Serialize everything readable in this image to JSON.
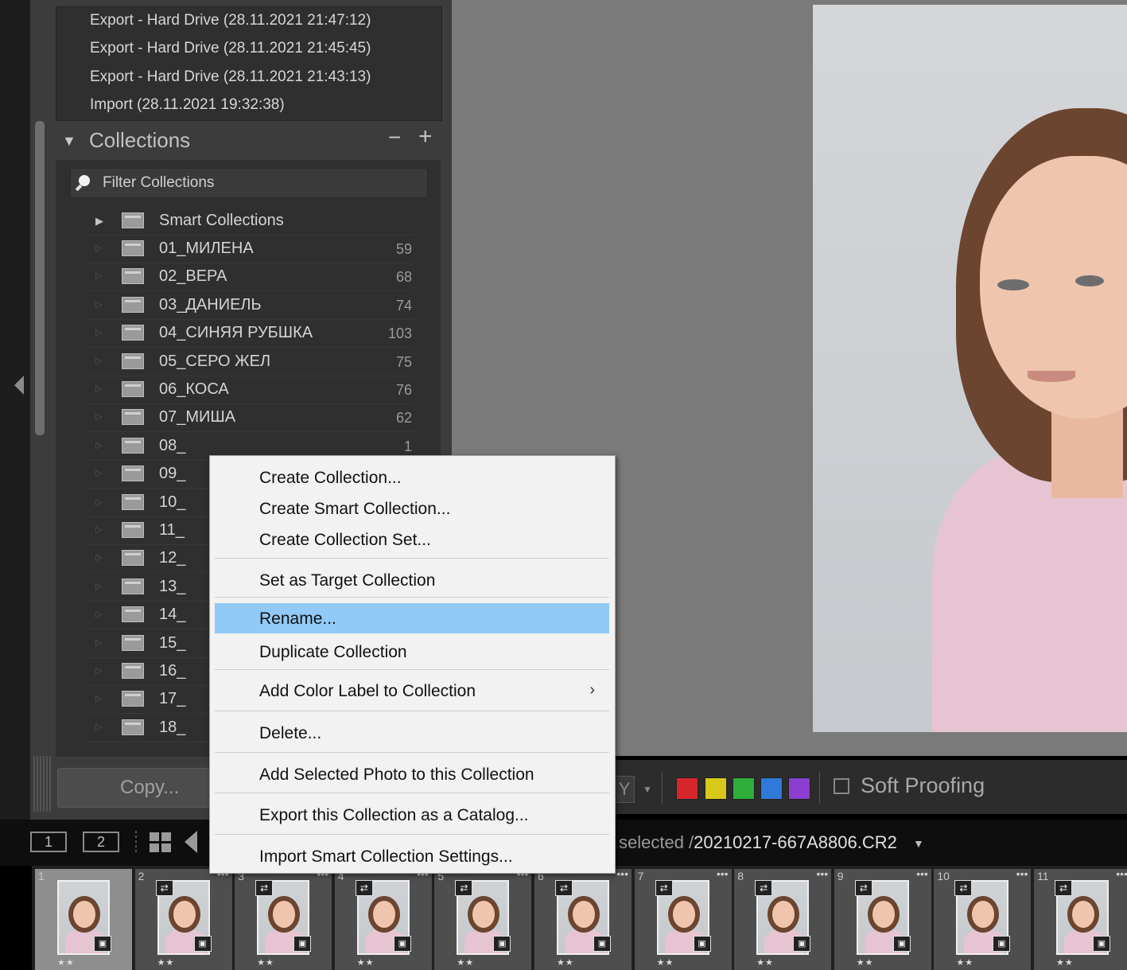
{
  "history": [
    "Export - Hard Drive (28.11.2021 21:47:12)",
    "Export - Hard Drive (28.11.2021 21:45:45)",
    "Export - Hard Drive (28.11.2021 21:43:13)",
    "Import (28.11.2021 19:32:38)"
  ],
  "collections": {
    "title": "Collections",
    "minus": "−",
    "plus": "+",
    "filter_placeholder": "Filter Collections",
    "smart_label": "Smart Collections",
    "items": [
      {
        "name": "01_МИЛЕНА",
        "count": "59"
      },
      {
        "name": "02_ВЕРА",
        "count": "68"
      },
      {
        "name": "03_ДАНИЕЛЬ",
        "count": "74"
      },
      {
        "name": "04_СИНЯЯ РУБШКА",
        "count": "103"
      },
      {
        "name": "05_СЕРО ЖЕЛ",
        "count": "75"
      },
      {
        "name": "06_КОСА",
        "count": "76"
      },
      {
        "name": "07_МИША",
        "count": "62"
      },
      {
        "name": "08_",
        "count": "1"
      },
      {
        "name": "09_",
        "count": ""
      },
      {
        "name": "10_",
        "count": ""
      },
      {
        "name": "11_",
        "count": ""
      },
      {
        "name": "12_",
        "count": ""
      },
      {
        "name": "13_",
        "count": ""
      },
      {
        "name": "14_",
        "count": ""
      },
      {
        "name": "15_",
        "count": ""
      },
      {
        "name": "16_",
        "count": ""
      },
      {
        "name": "17_",
        "count": ""
      },
      {
        "name": "18_",
        "count": ""
      }
    ],
    "copy_button": "Copy..."
  },
  "context_menu": {
    "items": [
      {
        "label": "Create Collection..."
      },
      {
        "label": "Create Smart Collection..."
      },
      {
        "label": "Create Collection Set..."
      },
      {
        "label": "Set as Target Collection"
      },
      {
        "label": "Rename...",
        "highlighted": true
      },
      {
        "label": "Duplicate Collection"
      },
      {
        "label": "Add Color Label to Collection",
        "submenu": "›"
      },
      {
        "label": "Delete..."
      },
      {
        "label": "Add Selected Photo to this Collection"
      },
      {
        "label": "Export this Collection as a Catalog..."
      },
      {
        "label": "Import Smart Collection Settings..."
      }
    ]
  },
  "toolbar": {
    "y_label": "Y",
    "soft_proofing": "Soft Proofing",
    "color_labels": [
      "#d7262b",
      "#d8c818",
      "#2fae3b",
      "#2e7ad8",
      "#8b3fd0"
    ]
  },
  "filmstrip": {
    "screen1": "1",
    "screen2": "2",
    "selected_prefix": "selected /",
    "filename": "20210217-667A8806.CR2",
    "thumbs": [
      {
        "num": "1",
        "stars": "★★"
      },
      {
        "num": "2",
        "stars": "★★"
      },
      {
        "num": "3",
        "stars": "★★"
      },
      {
        "num": "4",
        "stars": "★★"
      },
      {
        "num": "5",
        "stars": "★★"
      },
      {
        "num": "6",
        "stars": "★★"
      },
      {
        "num": "7",
        "stars": "★★"
      },
      {
        "num": "8",
        "stars": "★★"
      },
      {
        "num": "9",
        "stars": "★★"
      },
      {
        "num": "10",
        "stars": "★★"
      },
      {
        "num": "11",
        "stars": "★★"
      }
    ]
  }
}
